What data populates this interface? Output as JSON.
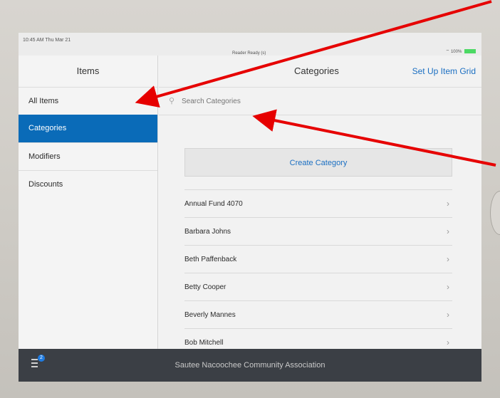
{
  "status": {
    "time": "10:45 AM  Thu Mar 21",
    "center": "Reader Ready (s)",
    "battery": "100%"
  },
  "sidebar": {
    "title": "Items",
    "items": [
      {
        "label": "All Items",
        "active": false
      },
      {
        "label": "Categories",
        "active": true
      },
      {
        "label": "Modifiers",
        "active": false
      },
      {
        "label": "Discounts",
        "active": false
      }
    ]
  },
  "main": {
    "title": "Categories",
    "grid_link": "Set Up Item Grid",
    "search_placeholder": "Search Categories",
    "create_label": "Create Category",
    "categories": [
      "Annual Fund 4070",
      "Barbara Johns",
      "Beth Paffenback",
      "Betty Cooper",
      "Beverly Mannes",
      "Bob Mitchell"
    ]
  },
  "bottom": {
    "org_name": "Sautee Nacoochee Community Association",
    "badge_count": "2"
  },
  "colors": {
    "accent": "#0a6bb8",
    "link": "#1b6fc2",
    "bottom_bar": "#3b3f45",
    "annotation_arrow": "#e60000"
  }
}
